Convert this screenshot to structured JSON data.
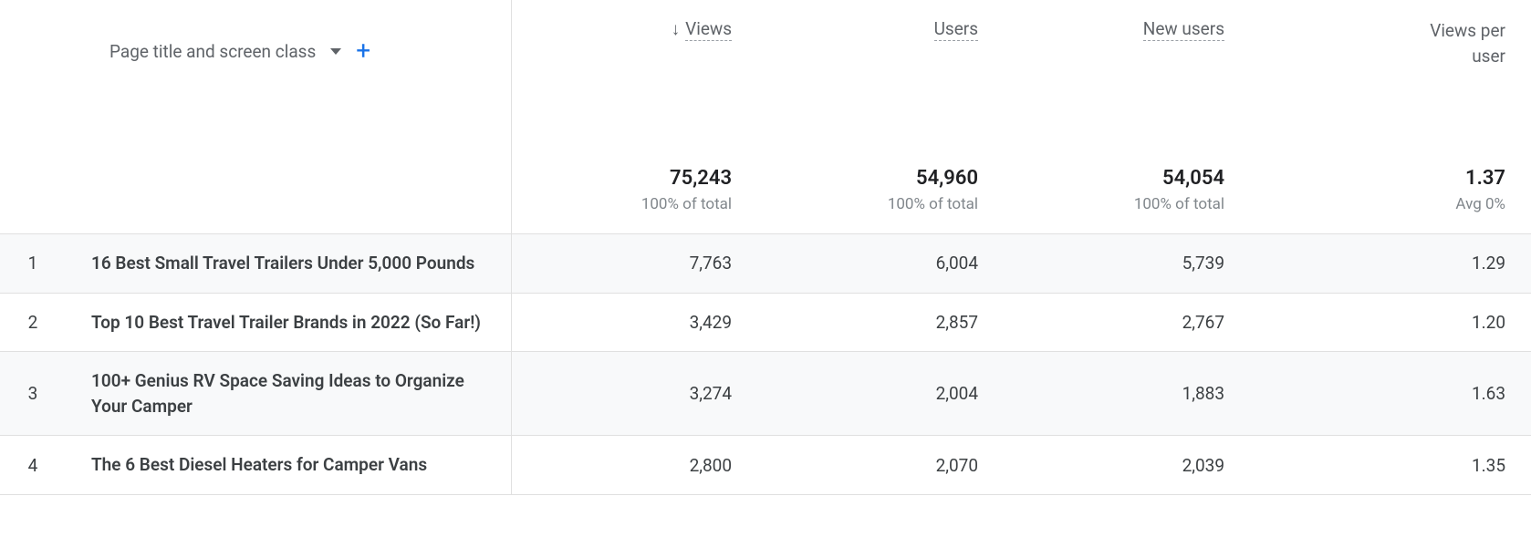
{
  "dimension": {
    "label": "Page title and screen class"
  },
  "columns": {
    "views": {
      "label": "Views",
      "sorted": true
    },
    "users": {
      "label": "Users"
    },
    "new_users": {
      "label": "New users"
    },
    "views_per_user_l1": "Views per",
    "views_per_user_l2": "user"
  },
  "totals": {
    "views": {
      "value": "75,243",
      "sub": "100% of total"
    },
    "users": {
      "value": "54,960",
      "sub": "100% of total"
    },
    "new_users": {
      "value": "54,054",
      "sub": "100% of total"
    },
    "views_per_user": {
      "value": "1.37",
      "sub": "Avg 0%"
    }
  },
  "rows": [
    {
      "index": "1",
      "title": "16 Best Small Travel Trailers Under 5,000 Pounds",
      "views": "7,763",
      "users": "6,004",
      "new_users": "5,739",
      "vpu": "1.29"
    },
    {
      "index": "2",
      "title": "Top 10 Best Travel Trailer Brands in 2022 (So Far!)",
      "views": "3,429",
      "users": "2,857",
      "new_users": "2,767",
      "vpu": "1.20"
    },
    {
      "index": "3",
      "title": "100+ Genius RV Space Saving Ideas to Organize Your Camper",
      "views": "3,274",
      "users": "2,004",
      "new_users": "1,883",
      "vpu": "1.63"
    },
    {
      "index": "4",
      "title": "The 6 Best Diesel Heaters for Camper Vans",
      "views": "2,800",
      "users": "2,070",
      "new_users": "2,039",
      "vpu": "1.35"
    }
  ]
}
